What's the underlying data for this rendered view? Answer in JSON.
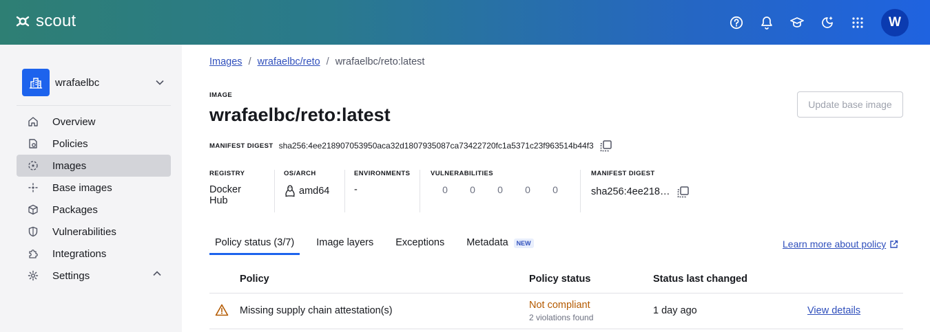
{
  "app": {
    "name": "scout"
  },
  "header": {
    "icons": [
      "help-icon",
      "bell-icon",
      "graduation-cap-icon",
      "theme-icon",
      "apps-grid-icon"
    ],
    "avatar_initial": "W"
  },
  "sidebar": {
    "org_name": "wrafaelbc",
    "items": [
      {
        "label": "Overview",
        "icon": "home-icon"
      },
      {
        "label": "Policies",
        "icon": "policy-icon"
      },
      {
        "label": "Images",
        "icon": "images-icon",
        "active": true
      },
      {
        "label": "Base images",
        "icon": "base-images-icon"
      },
      {
        "label": "Packages",
        "icon": "package-icon"
      },
      {
        "label": "Vulnerabilities",
        "icon": "shield-icon"
      },
      {
        "label": "Integrations",
        "icon": "puzzle-icon"
      },
      {
        "label": "Settings",
        "icon": "gear-icon"
      }
    ]
  },
  "breadcrumb": {
    "items": [
      "Images",
      "wrafaelbc/reto",
      "wrafaelbc/reto:latest"
    ],
    "separator": "/"
  },
  "image": {
    "overline": "IMAGE",
    "title": "wrafaelbc/reto:latest",
    "update_button": "Update base image",
    "digest_label": "MANIFEST DIGEST",
    "digest": "sha256:4ee218907053950aca32d1807935087ca73422720fc1a5371c23f963514b44f3"
  },
  "stats": {
    "registry": {
      "label": "REGISTRY",
      "value": "Docker Hub"
    },
    "os_arch": {
      "label": "OS/ARCH",
      "value": "amd64"
    },
    "environments": {
      "label": "ENVIRONMENTS",
      "value": "-"
    },
    "vulnerabilities": {
      "label": "VULNERABILITIES",
      "values": [
        "0",
        "0",
        "0",
        "0",
        "0"
      ]
    },
    "manifest_digest": {
      "label": "MANIFEST DIGEST",
      "value": "sha256:4ee218…"
    }
  },
  "tabs": [
    {
      "label": "Policy status (3/7)",
      "active": true
    },
    {
      "label": "Image layers"
    },
    {
      "label": "Exceptions"
    },
    {
      "label": "Metadata",
      "badge": "NEW"
    }
  ],
  "learn_more": "Learn more about policy",
  "policy_table": {
    "columns": [
      "Policy",
      "Policy status",
      "Status last changed"
    ],
    "rows": [
      {
        "policy": "Missing supply chain attestation(s)",
        "status": "Not compliant",
        "status_detail": "2 violations found",
        "changed": "1 day ago",
        "action": "View details"
      }
    ]
  },
  "colors": {
    "accent": "#1d63ed",
    "link": "#2f4fbc",
    "warning": "#b45a00",
    "sidebar_bg": "#f4f4f6"
  }
}
